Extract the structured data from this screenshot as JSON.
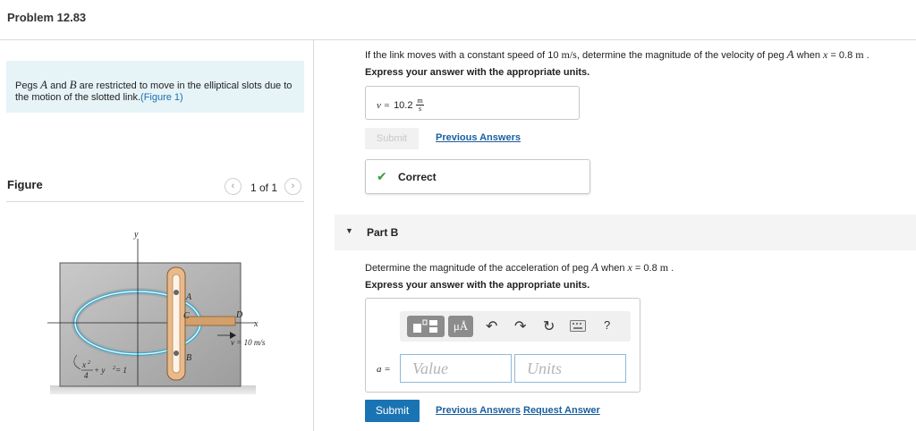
{
  "header": {
    "title": "Problem 12.83"
  },
  "statement": {
    "text_1": "Pegs ",
    "peg_a": "A",
    "text_2": " and ",
    "peg_b": "B",
    "text_3": " are restricted to move in the elliptical slots due to the motion of the slotted link.",
    "figure_link": "(Figure 1)"
  },
  "figure_panel": {
    "label": "Figure",
    "prev_icon": "chevron-left-icon",
    "next_icon": "chevron-right-icon",
    "count": "1 of 1",
    "labels": {
      "y": "y",
      "x": "x",
      "A": "A",
      "B": "B",
      "C": "C",
      "D": "D",
      "velocity": "v = 10 m/s",
      "eq_x": "x",
      "eq_sup": "2",
      "eq_den": "4",
      "eq_rest": " + y",
      "eq_end": " = 1"
    }
  },
  "part_a": {
    "question_pre": "If the link moves with a constant speed of 10 ",
    "question_unit": "m/s",
    "question_mid": ", determine the magnitude of the velocity of peg ",
    "question_peg": "A",
    "question_when": " when ",
    "question_var": "x",
    "question_val": " = 0.8 ",
    "question_m": "m",
    "question_end": " .",
    "instruction": "Express your answer with the appropriate units.",
    "answer_var": "v =",
    "answer_value": "10.2",
    "answer_unit_num": "m",
    "answer_unit_den": "s",
    "submit_label": "Submit",
    "previous_answers": "Previous Answers",
    "correct_icon": "checkmark-icon",
    "correct_text": "Correct"
  },
  "part_b": {
    "title": "Part B",
    "caret_icon": "caret-down-icon",
    "question_pre": "Determine the magnitude of the acceleration of peg ",
    "question_peg": "A",
    "question_when": " when ",
    "question_var": "x",
    "question_val": " = 0.8 ",
    "question_m": "m",
    "question_end": " .",
    "instruction": "Express your answer with the appropriate units.",
    "toolbar": {
      "template_icon": "template-icon",
      "units_button": "μÅ",
      "undo_icon": "undo-icon",
      "redo_icon": "redo-icon",
      "reset_icon": "reset-icon",
      "keyboard_icon": "keyboard-icon",
      "help": "?"
    },
    "answer_var": "a =",
    "value_placeholder": "Value",
    "units_placeholder": "Units",
    "submit_label": "Submit",
    "previous_answers": "Previous Answers",
    "request_answer": "Request Answer"
  }
}
